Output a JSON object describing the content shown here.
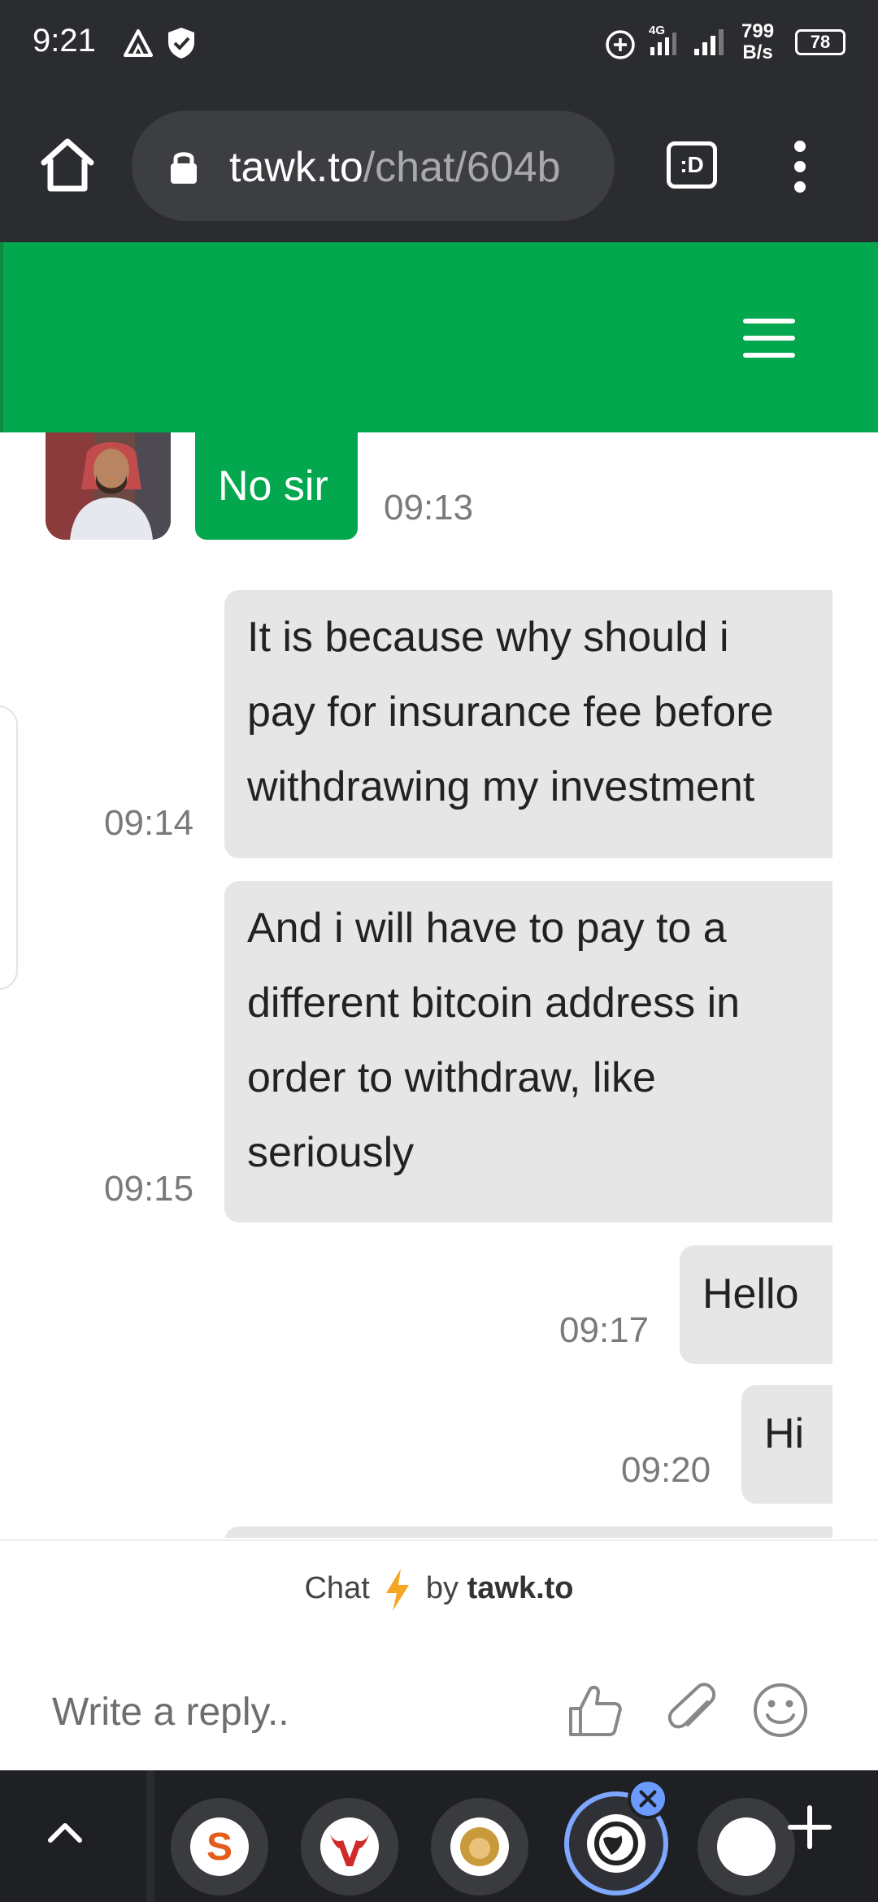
{
  "status_bar": {
    "time": "9:21",
    "network_speed_value": "799",
    "network_speed_unit": "B/s",
    "battery": "78",
    "signal_label": "4G"
  },
  "browser": {
    "url_host": "tawk.to",
    "url_path": "/chat/604b",
    "tab_switch_label": ":D"
  },
  "chat": {
    "messages": [
      {
        "from": "agent",
        "text": "No sir",
        "time": "09:13"
      },
      {
        "from": "visitor",
        "text_lines": [
          "It is because why should i",
          "pay for insurance fee before",
          "withdrawing my investment"
        ],
        "time": "09:14"
      },
      {
        "from": "visitor",
        "text_lines": [
          "And i will have to pay to a",
          "different bitcoin address in",
          "order to withdraw, like",
          "seriously"
        ],
        "time": "09:15"
      },
      {
        "from": "visitor",
        "text": "Hello",
        "time": "09:17"
      },
      {
        "from": "visitor",
        "text": "Hi",
        "time": "09:20"
      }
    ]
  },
  "footer": {
    "branding_prefix": "Chat",
    "branding_by": "by",
    "branding_name": "tawk.to",
    "reply_placeholder": "Write a reply.."
  },
  "icons": {
    "home": "home-icon",
    "lock": "lock-icon",
    "menu": "more-vert-icon",
    "hamburger": "hamburger-menu-icon",
    "like": "thumbs-up-icon",
    "attach": "paperclip-icon",
    "emoji": "smiley-icon"
  },
  "colors": {
    "brand_green": "#03a84e",
    "bubble_grey": "#e6e6e6",
    "browser_dark": "#2b2c2f"
  }
}
